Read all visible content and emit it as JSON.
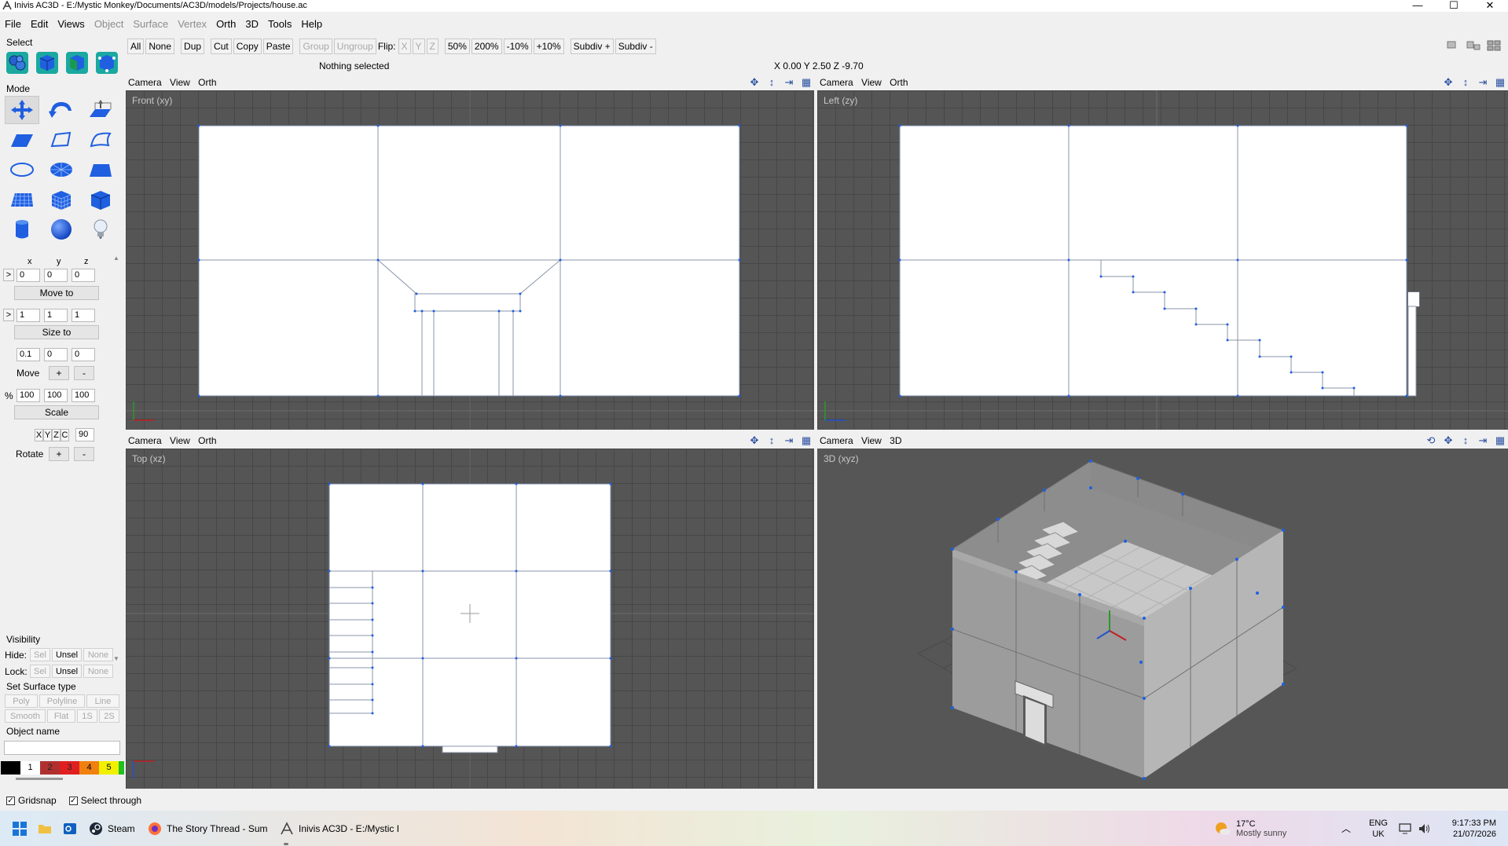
{
  "window": {
    "title": "Inivis AC3D - E:/Mystic Monkey/Documents/AC3D/models/Projects/house.ac",
    "controls": [
      "—",
      "☐",
      "✕"
    ]
  },
  "menu": [
    {
      "label": "File",
      "enabled": true
    },
    {
      "label": "Edit",
      "enabled": true
    },
    {
      "label": "Views",
      "enabled": true
    },
    {
      "label": "Object",
      "enabled": false
    },
    {
      "label": "Surface",
      "enabled": false
    },
    {
      "label": "Vertex",
      "enabled": false
    },
    {
      "label": "Orth",
      "enabled": true
    },
    {
      "label": "3D",
      "enabled": true
    },
    {
      "label": "Tools",
      "enabled": true
    },
    {
      "label": "Help",
      "enabled": true
    }
  ],
  "left_panel": {
    "select_label": "Select",
    "mode_label": "Mode",
    "xyz_labels": [
      "x",
      "y",
      "z"
    ],
    "arrow_label": ">",
    "position": [
      "0",
      "0",
      "0"
    ],
    "move_to": "Move to",
    "size": [
      "1",
      "1",
      "1"
    ],
    "size_to": "Size to",
    "move_step": [
      "0.1",
      "0",
      "0"
    ],
    "move_label": "Move",
    "plus": "+",
    "minus": "-",
    "percent_label": "%",
    "scale_values": [
      "100",
      "100",
      "100"
    ],
    "scale": "Scale",
    "rotate_axes": [
      "X",
      "Y",
      "Z",
      "C"
    ],
    "rotate_angle": "90",
    "rotate_label": "Rotate",
    "visibility_label": "Visibility",
    "hide_label": "Hide:",
    "lock_label": "Lock:",
    "vis_buttons": [
      "Sel",
      "Unsel",
      "None"
    ],
    "surface_type_label": "Set Surface type",
    "surface_buttons": [
      "Poly",
      "Polyline",
      "Line"
    ],
    "shading_buttons": [
      "Smooth",
      "Flat",
      "1S",
      "2S"
    ],
    "object_name_label": "Object name",
    "object_name_value": "",
    "palette": [
      {
        "label": "",
        "color": "#000000"
      },
      {
        "label": "1",
        "color": "#ffffff"
      },
      {
        "label": "2",
        "color": "#b03030"
      },
      {
        "label": "3",
        "color": "#e02020"
      },
      {
        "label": "4",
        "color": "#f08010"
      },
      {
        "label": "5",
        "color": "#f0f000"
      },
      {
        "label": "",
        "color": "#20c020"
      }
    ]
  },
  "toolbar": {
    "buttons_a": [
      {
        "label": "All",
        "enabled": true
      },
      {
        "label": "None",
        "enabled": true
      }
    ],
    "dup": "Dup",
    "edit_buttons": [
      {
        "label": "Cut",
        "enabled": true
      },
      {
        "label": "Copy",
        "enabled": true
      },
      {
        "label": "Paste",
        "enabled": true
      }
    ],
    "group_buttons": [
      {
        "label": "Group",
        "enabled": false
      },
      {
        "label": "Ungroup",
        "enabled": false
      }
    ],
    "flip_label": "Flip:",
    "flip_axes": [
      "X",
      "Y",
      "Z"
    ],
    "zoom_buttons": [
      "50%",
      "200%",
      "-10%",
      "+10%"
    ],
    "subdiv_buttons": [
      "Subdiv +",
      "Subdiv -"
    ]
  },
  "status": "Nothing selected",
  "coordinate_readout": "X 0.00 Y 2.50 Z -9.70",
  "viewports": [
    {
      "id": "front",
      "menus": [
        "Camera",
        "View",
        "Orth"
      ],
      "label": "Front (xy)"
    },
    {
      "id": "left",
      "menus": [
        "Camera",
        "View",
        "Orth"
      ],
      "label": "Left (zy)"
    },
    {
      "id": "top",
      "menus": [
        "Camera",
        "View",
        "Orth"
      ],
      "label": "Top (xz)"
    },
    {
      "id": "persp",
      "menus": [
        "Camera",
        "View",
        "3D"
      ],
      "label": "3D (xyz)"
    }
  ],
  "bottom": {
    "gridsnap": "Gridsnap",
    "select_through": "Select through"
  },
  "taskbar": {
    "apps": [
      {
        "label": "Steam"
      },
      {
        "label": "The Story Thread - Sum"
      },
      {
        "label": "Inivis AC3D - E:/Mystic I"
      }
    ],
    "weather_temp": "17°C",
    "weather_desc": "Mostly sunny",
    "lang_top": "ENG",
    "lang_bottom": "UK",
    "time": "9:17:33 PM",
    "date": "21/07/2026"
  }
}
